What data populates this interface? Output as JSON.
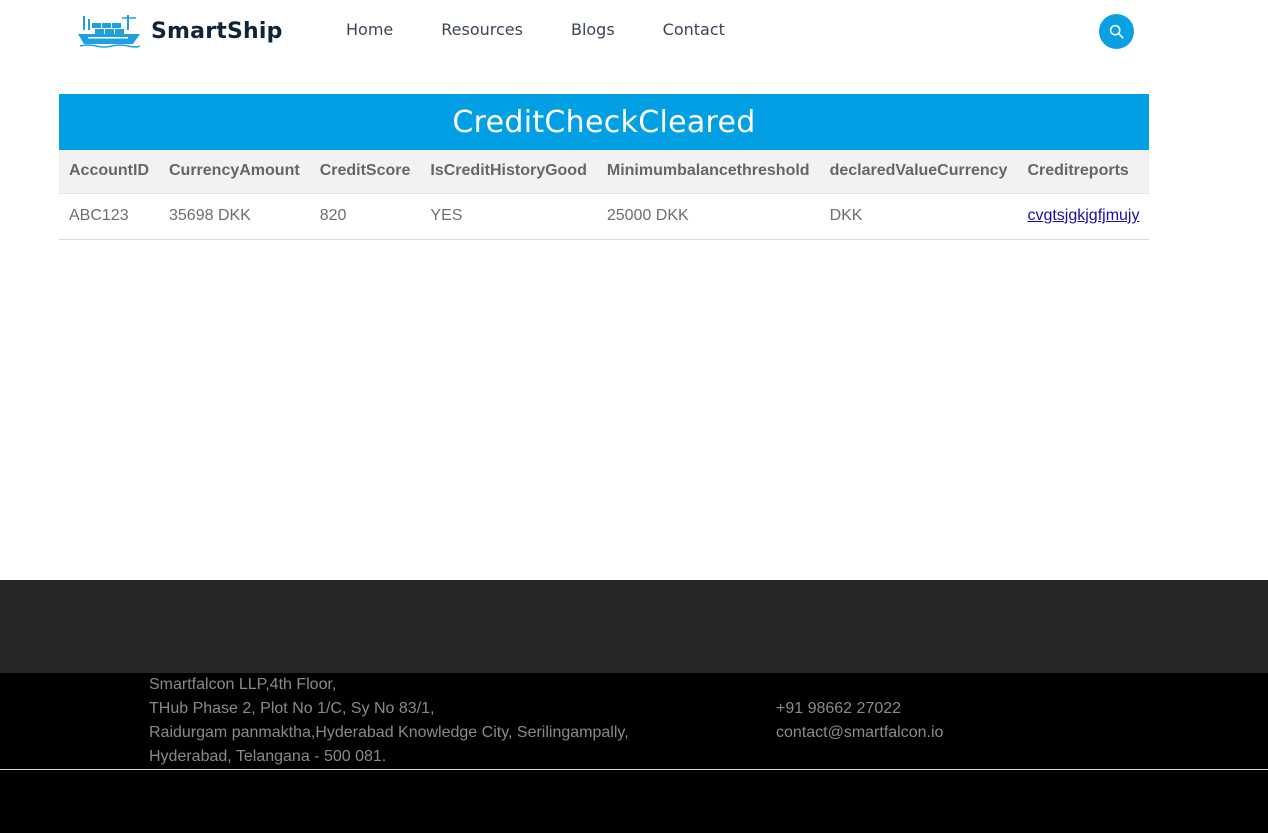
{
  "brand": {
    "name": "SmartShip",
    "logo_icon": "container-ship-icon",
    "accent": "#0aa1e4"
  },
  "nav": {
    "items": [
      {
        "label": "Home"
      },
      {
        "label": "Resources"
      },
      {
        "label": "Blogs"
      },
      {
        "label": "Contact"
      }
    ]
  },
  "search": {
    "icon": "search-icon"
  },
  "panel": {
    "title": "CreditCheckCleared",
    "title_bg": "#039fe4",
    "headers": [
      "AccountID",
      "CurrencyAmount",
      "CreditScore",
      "IsCreditHistoryGood",
      "Minimumbalancethreshold",
      "declaredValueCurrency",
      "Creditreports"
    ],
    "rows": [
      [
        "ABC123",
        "35698 DKK",
        "820",
        "YES",
        "25000 DKK",
        "DKK",
        "cvgtsjgkjgfjmujy"
      ]
    ]
  },
  "footer": {
    "address": [
      "Smartfalcon LLP,4th Floor,",
      "THub Phase 2, Plot No 1/C, Sy No 83/1,",
      "Raidurgam panmaktha,Hyderabad Knowledge City, Serilingampally,",
      "Hyderabad, Telangana - 500 081."
    ],
    "phone": "+91 98662 27022",
    "email": "contact@smartfalcon.io"
  }
}
